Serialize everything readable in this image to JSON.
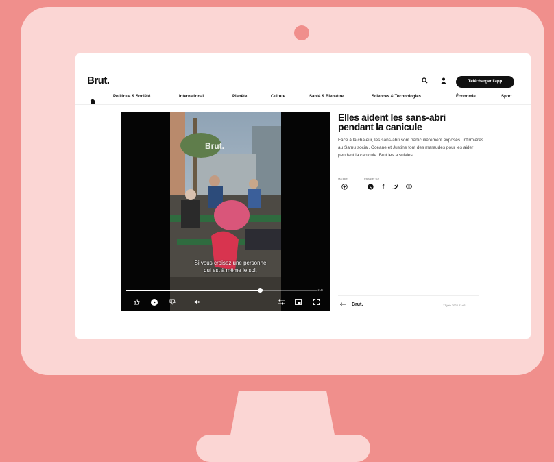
{
  "brand": {
    "logo": "Brut",
    "logo_dot": "."
  },
  "header": {
    "search_icon": "search-icon",
    "user_icon": "user-icon",
    "download_label": "Télécharger l'app"
  },
  "nav": {
    "home_icon": "home-icon",
    "items": [
      "Politique & Société",
      "International",
      "Planète",
      "Culture",
      "Santé & Bien-être",
      "Sciences & Technologies",
      "Économie",
      "Sport"
    ]
  },
  "video": {
    "watermark": "Brut.",
    "subtitle_line1": "Si vous croisez une personne",
    "subtitle_line2": "qui est à même le sol,",
    "progress": 0.7,
    "time": "1:08",
    "controls": [
      "like-icon",
      "play-icon",
      "dislike-icon",
      "mute-icon",
      "settings-icon",
      "pip-icon",
      "fullscreen-icon"
    ]
  },
  "article": {
    "title": "Elles aident les sans-abri pendant la canicule",
    "description": "Face à la chaleur, les sans-abri sont particulièrement exposés. Infirmières au Samu social, Océane et Justine font des maraudes pour les aider pendant la canicule. Brut les a suivies.",
    "ma_liste_label": "Ma liste",
    "share_label": "Partager sur",
    "share_icons": [
      "whatsapp-icon",
      "facebook-icon",
      "twitter-icon",
      "link-icon"
    ]
  },
  "footer": {
    "brand": "Brut.",
    "date": "17 juin 2022 21:01"
  },
  "colors": {
    "background": "#f08f8c",
    "monitor": "#fbd6d4",
    "accent_dark": "#111111"
  }
}
